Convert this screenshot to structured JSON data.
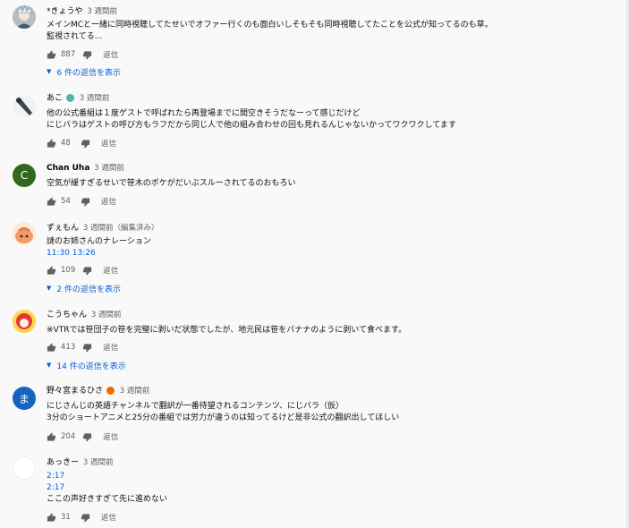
{
  "comments": [
    {
      "author": "*きょうや",
      "time": "3 週間前",
      "lines": [
        "メインMCと一緒に同時視聴してたせいでオファー行くのも面白いしそもそも同時視聴してたことを公式が知ってるのも草。",
        "監視されてる..."
      ],
      "likes": "887",
      "reply_label": "返信",
      "replies_label": "6 件の返信を表示"
    },
    {
      "author": "あこ",
      "time": "3 週間前",
      "lines": [
        "他の公式番組は１度ゲストで呼ばれたら再登場までに間空きそうだなーって感じだけど",
        "にじバラはゲストの呼び方もラフだから同じ人で他の組み合わせの回も見れるんじゃないかってワクワクしてます"
      ],
      "likes": "48",
      "reply_label": "返信"
    },
    {
      "author": "Chan Uha",
      "avatar_letter": "C",
      "time": "3 週間前",
      "lines": [
        "空気が緩すぎるせいで笹木のボケがだいぶスルーされてるのおもろい"
      ],
      "likes": "54",
      "reply_label": "返信"
    },
    {
      "author": "ずぇもん",
      "time": "3 週間前（編集済み）",
      "lines": [
        "謎のお姉さんのナレーション"
      ],
      "link_line": "11:30 13:26",
      "likes": "109",
      "reply_label": "返信",
      "replies_label": "2 件の返信を表示"
    },
    {
      "author": "こうちゃん",
      "time": "3 週間前",
      "lines": [
        "※VTRでは笹団子の笹を完璧に剥いだ状態でしたが、地元民は笹をバナナのように剥いて食べます。"
      ],
      "likes": "413",
      "reply_label": "返信",
      "replies_label": "14 件の返信を表示"
    },
    {
      "author": "野々宮まるひさ",
      "avatar_letter": "ま",
      "time": "3 週間前",
      "lines": [
        "にじさんじの英語チャンネルで翻訳が一番待望されるコンテンツ、にじバラ（仮）",
        "3分のショートアニメと25分の番組では労力が違うのは知ってるけど是非公式の翻訳出してほしい"
      ],
      "likes": "204",
      "reply_label": "返信"
    },
    {
      "author": "あっきー",
      "time": "3 週間前",
      "link_lines": [
        "2:17",
        "2:17"
      ],
      "lines": [
        "ここの声好きすぎて先に進めない"
      ],
      "likes": "31",
      "reply_label": "返信"
    }
  ],
  "colors": {
    "link": "#065fd4",
    "avatar_chan": "#33691e",
    "avatar_ma": "#1565c0",
    "secondary_text": "#606060"
  },
  "icons": {
    "like": "thumbs-up-icon",
    "dislike": "thumbs-down-icon",
    "expand": "chevron-down-icon"
  }
}
